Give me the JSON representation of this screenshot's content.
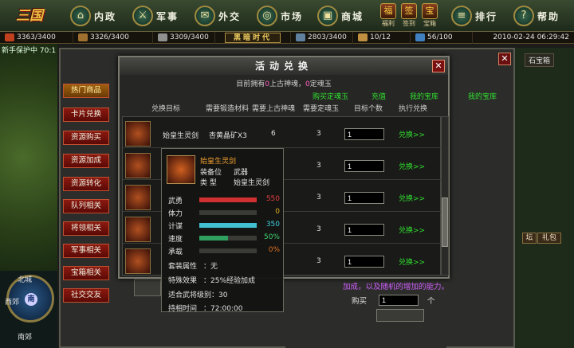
{
  "game": {
    "logo": "三国"
  },
  "nav": [
    {
      "label": "内政",
      "icon": "castle-icon",
      "glyph": "⌂"
    },
    {
      "label": "军事",
      "icon": "swords-icon",
      "glyph": "⚔"
    },
    {
      "label": "外交",
      "icon": "scroll-icon",
      "glyph": "✉"
    },
    {
      "label": "市场",
      "icon": "coins-icon",
      "glyph": "◎"
    },
    {
      "label": "商城",
      "icon": "chest-icon",
      "glyph": "▣"
    },
    {
      "label": "排行",
      "icon": "rank-scroll-icon",
      "glyph": "≡"
    },
    {
      "label": "帮助",
      "icon": "book-icon",
      "glyph": "?"
    }
  ],
  "small_icons": [
    {
      "label": "福利",
      "glyph": "福"
    },
    {
      "label": "签到",
      "glyph": "签"
    },
    {
      "label": "宝箱",
      "glyph": "宝"
    }
  ],
  "resources": {
    "r1": "3363/3400",
    "r2": "3326/3400",
    "r3": "3309/3400",
    "era": "黑暗时代",
    "r4": "2803/3400",
    "r5": "10/12",
    "r6": "56/100",
    "datetime": "2010-02-24 06:29:42"
  },
  "map": {
    "protect_text": "新手保护中 70:1",
    "north": "北城",
    "west": "西郊",
    "south": "南郊",
    "center": "南"
  },
  "side_menu": [
    "热门商品",
    "卡片兑换",
    "资源购买",
    "资源加成",
    "资源转化",
    "队列相关",
    "将领相关",
    "军事相关",
    "宝箱相关",
    "社交交友"
  ],
  "right_strip": {
    "stone": "石宝箱",
    "tan": "坛",
    "libao": "礼包"
  },
  "dialog": {
    "title": "活动兑换",
    "own_prefix": "目前拥有",
    "own_count1": "0",
    "own_mid": "上古神魂，",
    "own_count2": "0",
    "own_suffix": "定魂玉",
    "link_buy": "购买定魂玉",
    "link_recharge": "充值",
    "link_treasury": "我的宝库",
    "link_treasury2": "我的宝库",
    "columns": [
      "兑换目标",
      "需要锻造材料",
      "需要上古神魂",
      "需要定魂玉",
      "目标个数",
      "执行兑换"
    ],
    "rows": [
      {
        "name": "始皇生灵剑",
        "material": "杏黄晶矿X3",
        "soul": "6",
        "jade": "3",
        "qty": "1",
        "action": "兑换>>"
      },
      {
        "name": "",
        "material": "",
        "soul": "",
        "jade": "3",
        "qty": "1",
        "action": "兑换>>"
      },
      {
        "name": "",
        "material": "",
        "soul": "",
        "jade": "3",
        "qty": "1",
        "action": "兑换>>"
      },
      {
        "name": "",
        "material": "",
        "soul": "",
        "jade": "3",
        "qty": "1",
        "action": "兑换>>"
      },
      {
        "name": "",
        "material": "",
        "soul": "",
        "jade": "3",
        "qty": "1",
        "action": "兑换>>"
      }
    ]
  },
  "tooltip": {
    "name": "始皇生灵剑",
    "slot_label": "装备位",
    "slot_value": "武器",
    "type_label": "类 型",
    "type_value": "始皇生灵剑",
    "stats": [
      {
        "label": "武勇",
        "value": "550",
        "fraction": 1.0,
        "color": "#d03030",
        "text_color": "#e04040"
      },
      {
        "label": "体力",
        "value": "0",
        "fraction": 0.0,
        "color": "#d0a020",
        "text_color": "#e0b020"
      },
      {
        "label": "计谋",
        "value": "350",
        "fraction": 1.0,
        "color": "#40c0d0",
        "text_color": "#40d0e0"
      },
      {
        "label": "速度",
        "value": "50%",
        "fraction": 0.5,
        "color": "#30a060",
        "text_color": "#40d070"
      },
      {
        "label": "承载",
        "value": "0%",
        "fraction": 0.0,
        "color": "#d06020",
        "text_color": "#e07020"
      }
    ],
    "set_label": "套装属性",
    "set_value": "：无",
    "special_label": "特殊效果",
    "special_value": "：25%经验加成",
    "level_label": "适合武将级别",
    "level_value": "：30",
    "duration_label": "持相时间",
    "duration_value": "：72:00:00"
  },
  "bottom": {
    "text": "加成，以及随机的增加的能力。",
    "buy_label": "购买",
    "buy_value": "1",
    "unit": "个"
  }
}
